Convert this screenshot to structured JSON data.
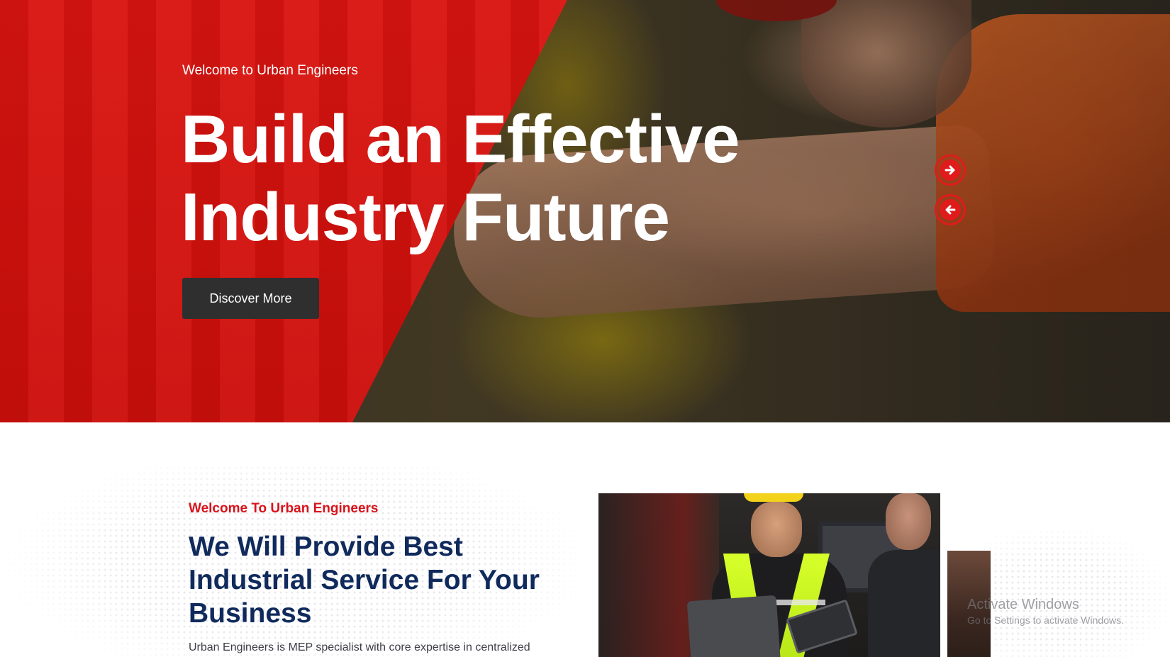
{
  "hero": {
    "subtitle": "Welcome to Urban Engineers",
    "title_line1": "Build an Effective",
    "title_line2": "Industry Future",
    "button_label": "Discover More",
    "accent_color": "#d91410",
    "arrow_next_icon": "arrow-right-circle-icon",
    "arrow_prev_icon": "arrow-left-circle-icon"
  },
  "about": {
    "eyebrow": "Welcome To Urban Engineers",
    "heading_line1": "We Will Provide Best",
    "heading_line2": "Industrial Service For Your",
    "heading_line3": "Business",
    "text": "Urban Engineers is MEP specialist with core expertise in centralized",
    "eyebrow_color": "#d8131b",
    "heading_color": "#102a5c"
  },
  "watermark": {
    "title": "Activate Windows",
    "subtitle": "Go to Settings to activate Windows."
  }
}
